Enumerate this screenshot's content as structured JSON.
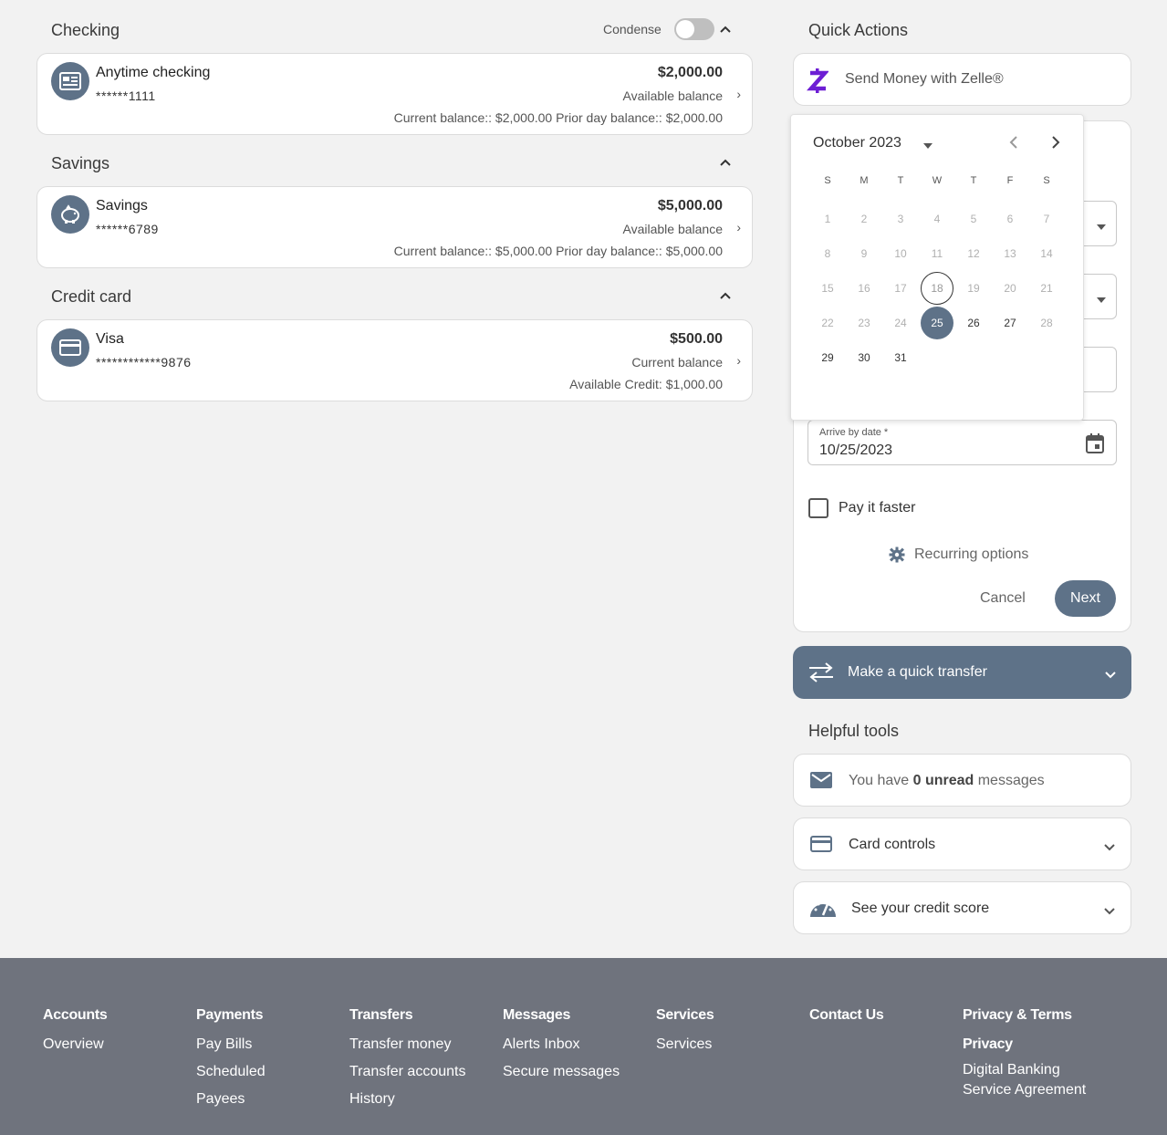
{
  "accounts": {
    "condense_label": "Condense",
    "checking": {
      "section_title": "Checking",
      "name": "Anytime checking",
      "number": "******1111",
      "balance": "$2,000.00",
      "balance_label": "Available balance",
      "extra": "Current balance:: $2,000.00  Prior day balance:: $2,000.00"
    },
    "savings": {
      "section_title": "Savings",
      "name": "Savings",
      "number": "******6789",
      "balance": "$5,000.00",
      "balance_label": "Available balance",
      "extra": "Current balance:: $5,000.00  Prior day balance:: $5,000.00"
    },
    "credit": {
      "section_title": "Credit card",
      "name": "Visa",
      "number": "************9876",
      "balance": "$500.00",
      "balance_label": "Current balance",
      "extra": "Available Credit: $1,000.00"
    }
  },
  "quick_actions": {
    "title": "Quick Actions",
    "zelle_label": "Send Money with Zelle®",
    "calendar": {
      "month_label": "October 2023",
      "weekdays": [
        "S",
        "M",
        "T",
        "W",
        "T",
        "F",
        "S"
      ],
      "days": [
        "1",
        "2",
        "3",
        "4",
        "5",
        "6",
        "7",
        "8",
        "9",
        "10",
        "11",
        "12",
        "13",
        "14",
        "15",
        "16",
        "17",
        "18",
        "19",
        "20",
        "21",
        "22",
        "23",
        "24",
        "25",
        "26",
        "27",
        "28",
        "29",
        "30",
        "31"
      ],
      "today": "18",
      "selected": "25"
    },
    "arrive_label": "Arrive by date *",
    "arrive_value": "10/25/2023",
    "pay_faster_label": "Pay it faster",
    "recurring_label": "Recurring options",
    "cancel_label": "Cancel",
    "next_label": "Next",
    "transfer_label": "Make a quick transfer"
  },
  "helpful_tools": {
    "title": "Helpful tools",
    "messages_prefix": "You have ",
    "messages_count": "0 unread",
    "messages_suffix": " messages",
    "card_controls": "Card controls",
    "credit_score": "See your credit score"
  },
  "footer": {
    "columns": [
      {
        "heading": "Accounts",
        "links": [
          "Overview"
        ]
      },
      {
        "heading": "Payments",
        "links": [
          "Pay Bills",
          "Scheduled",
          "Payees"
        ]
      },
      {
        "heading": "Transfers",
        "links": [
          "Transfer money",
          "Transfer accounts",
          "History"
        ]
      },
      {
        "heading": "Messages",
        "links": [
          "Alerts Inbox",
          "Secure messages"
        ]
      },
      {
        "heading": "Services",
        "links": [
          "Services"
        ]
      },
      {
        "heading": "Contact Us",
        "links": []
      },
      {
        "heading": "Privacy & Terms",
        "links": [],
        "bold_link": "Privacy",
        "extra_links": [
          "Digital Banking",
          "Service Agreement"
        ]
      }
    ]
  },
  "colors": {
    "accent": "#5e7288",
    "footer": "#6f737d",
    "zelle": "#6d1ed4"
  }
}
